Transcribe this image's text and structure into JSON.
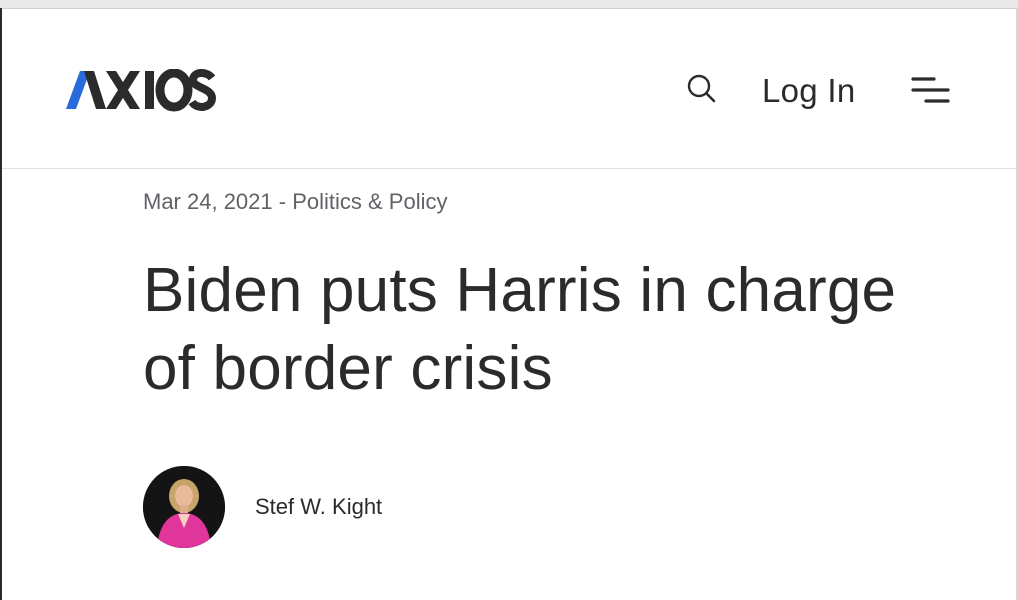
{
  "header": {
    "logo_text": "AXIOS",
    "login_label": "Log In",
    "search_icon": "search-icon",
    "menu_icon": "hamburger-menu-icon"
  },
  "article": {
    "date": "Mar 24, 2021",
    "separator": " - ",
    "category": "Politics & Policy",
    "headline": "Biden puts Harris in charge of border crisis",
    "author": "Stef W. Kight"
  },
  "colors": {
    "brand_blue": "#2a6bdc",
    "text_dark": "#2b2b2b",
    "meta_gray": "#5f6368",
    "avatar_pink": "#e0359b"
  }
}
